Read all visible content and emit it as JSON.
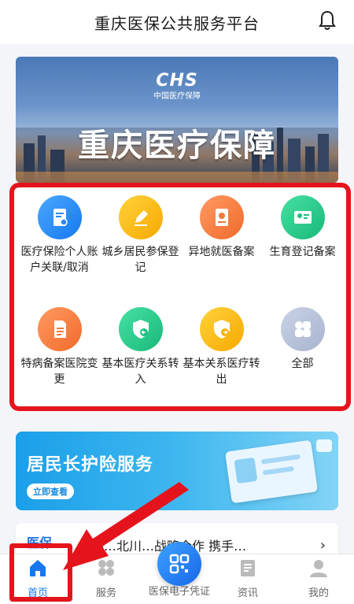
{
  "header": {
    "title": "重庆医保公共服务平台",
    "bell_icon": "bell-icon"
  },
  "banner": {
    "logo_mark": "CHS",
    "logo_sub": "中国医疗保障",
    "title": "重庆医疗保障"
  },
  "services": [
    {
      "label": "医疗保险个人账户关联/取消",
      "icon": "document-link-icon",
      "color": "c-blue"
    },
    {
      "label": "城乡居民参保登记",
      "icon": "pencil-icon",
      "color": "c-yellow"
    },
    {
      "label": "异地就医备案",
      "icon": "location-book-icon",
      "color": "c-orange"
    },
    {
      "label": "生育登记备案",
      "icon": "id-card-icon",
      "color": "c-green"
    },
    {
      "label": "特病备案医院变更",
      "icon": "document-icon",
      "color": "c-orange"
    },
    {
      "label": "基本医疗关系转入",
      "icon": "shield-in-icon",
      "color": "c-green"
    },
    {
      "label": "基本关系医疗转出",
      "icon": "shield-out-icon",
      "color": "c-yellow"
    },
    {
      "label": "全部",
      "icon": "grid-icon",
      "color": "c-grey"
    }
  ],
  "care": {
    "title": "居民长护险服务",
    "button": "立即查看"
  },
  "news": {
    "tag": "医保",
    "text": "携手…北川…战略合作 携手…"
  },
  "tabs": {
    "home": "首页",
    "service": "服务",
    "center": "医保电子凭证",
    "news": "资讯",
    "mine": "我的"
  }
}
